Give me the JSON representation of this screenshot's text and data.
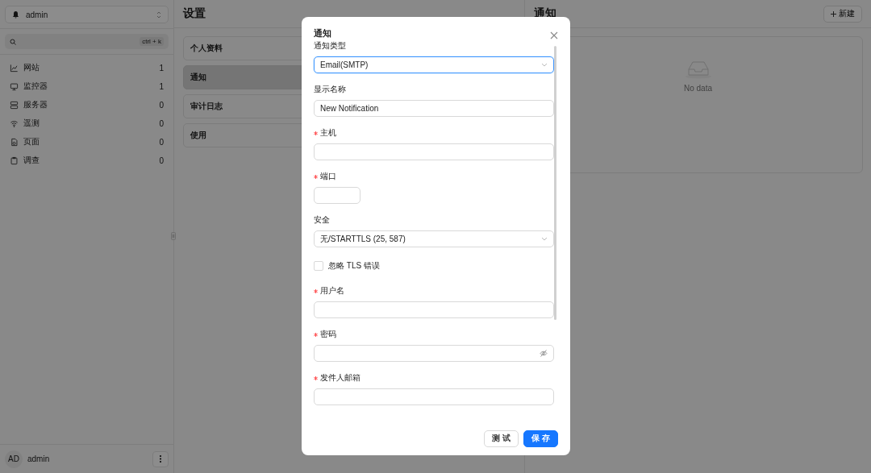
{
  "sidebar": {
    "workspace": "admin",
    "search": {
      "shortcut": "ctrl + k"
    },
    "nav_items": [
      {
        "label": "网站",
        "count": "1"
      },
      {
        "label": "监控器",
        "count": "1"
      },
      {
        "label": "服务器",
        "count": "0"
      },
      {
        "label": "遥测",
        "count": "0"
      },
      {
        "label": "页面",
        "count": "0"
      },
      {
        "label": "调查",
        "count": "0"
      }
    ],
    "user": {
      "avatar": "AD",
      "name": "admin"
    }
  },
  "settings": {
    "title": "设置",
    "items": [
      {
        "label": "个人资料",
        "selected": false
      },
      {
        "label": "通知",
        "selected": true
      },
      {
        "label": "审计日志",
        "selected": false
      },
      {
        "label": "使用",
        "selected": false
      }
    ]
  },
  "notifications": {
    "title": "通知",
    "new_button": "新建",
    "empty_text": "No data"
  },
  "dialog": {
    "title": "通知",
    "fields": [
      {
        "kind": "select",
        "label": "通知类型",
        "required": false,
        "value": "Email(SMTP)",
        "focused": true
      },
      {
        "kind": "text",
        "label": "显示名称",
        "required": false,
        "value": "New Notification",
        "focused": false
      },
      {
        "kind": "text",
        "label": "主机",
        "required": true,
        "focused": false
      },
      {
        "kind": "short",
        "label": "端口",
        "required": true,
        "focused": false
      },
      {
        "kind": "select",
        "label": "安全",
        "required": false,
        "value": "无/STARTTLS (25, 587)",
        "focused": false
      },
      {
        "kind": "checkbox",
        "label": "忽略 TLS 错误",
        "checked": false
      },
      {
        "kind": "text",
        "label": "用户名",
        "required": true,
        "focused": false
      },
      {
        "kind": "password",
        "label": "密码",
        "required": true,
        "focused": false
      },
      {
        "kind": "text",
        "label": "发件人邮箱",
        "required": true,
        "focused": false
      }
    ],
    "buttons": [
      {
        "label": "测 试",
        "kind": "default"
      },
      {
        "label": "保 存",
        "kind": "primary"
      }
    ]
  }
}
